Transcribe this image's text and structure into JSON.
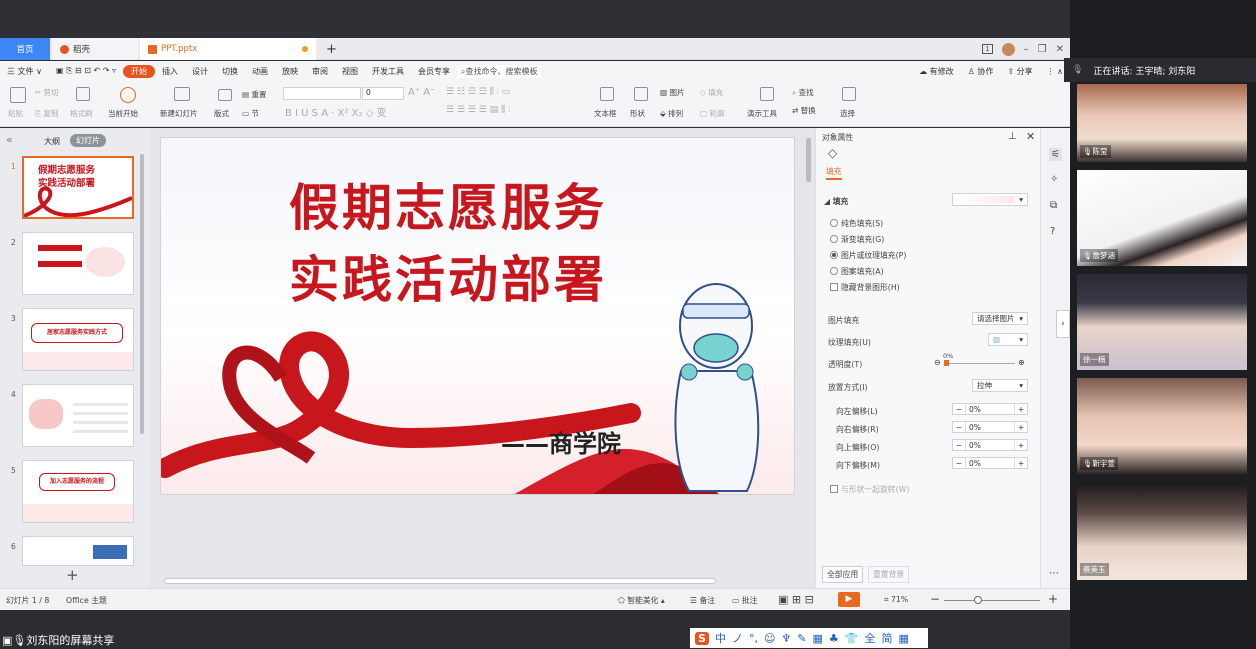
{
  "tabs": {
    "home": "首页",
    "docer": "稻壳",
    "ppt": "PPT.pptx",
    "add": "+"
  },
  "menu": {
    "file": "三 文件 ∨",
    "items": [
      "开始",
      "插入",
      "设计",
      "切换",
      "动画",
      "放映",
      "审阅",
      "视图",
      "开发工具",
      "会员专享"
    ],
    "search": "查找命令、搜索模板",
    "edit": "有修改",
    "collab": "协作",
    "share": "分享"
  },
  "ribbon": {
    "paste": "粘贴",
    "cut": "剪切",
    "copy": "复制",
    "format": "格式刷",
    "start_from": "当前开始",
    "new_slide": "新建幻灯片",
    "layout": "版式",
    "section": "节",
    "reset": "重置",
    "font_size": "0",
    "textbox": "文本框",
    "shape": "形状",
    "arrange": "排列",
    "picture": "图片",
    "fill": "填充",
    "outline": "轮廓",
    "present_tools": "演示工具",
    "find": "查找",
    "replace": "替换",
    "select": "选择"
  },
  "thumbs": {
    "outline": "大纲",
    "slides": "幻灯片",
    "nums": [
      "1",
      "2",
      "3",
      "4",
      "5",
      "6"
    ],
    "add": "+",
    "t1a": "假期志愿服务",
    "t1b": "实践活动部署",
    "t3": "居家志愿服务实践方式",
    "t5": "加入志愿服务的流程"
  },
  "slide": {
    "line1": "假期志愿服务",
    "line2": "实践活动部署",
    "sub": "——商学院"
  },
  "props": {
    "title": "对象属性",
    "tab": "填充",
    "section": "填充",
    "options": [
      "纯色填充(S)",
      "渐变填充(G)",
      "图片或纹理填充(P)",
      "图案填充(A)"
    ],
    "hide_bg": "隐藏背景图形(H)",
    "pic_fill": "图片填充",
    "pic_choose": "请选择图片",
    "texture": "纹理填充(U)",
    "transparency": "透明度(T)",
    "transparency_val": "0%",
    "placement": "放置方式(I)",
    "placement_val": "拉伸",
    "offsets": [
      {
        "label": "向左偏移(L)",
        "val": "0%"
      },
      {
        "label": "向右偏移(R)",
        "val": "0%"
      },
      {
        "label": "向上偏移(O)",
        "val": "0%"
      },
      {
        "label": "向下偏移(M)",
        "val": "0%"
      }
    ],
    "rotate": "与形状一起旋转(W)",
    "apply_all": "全部应用",
    "reset_bg": "重置背景"
  },
  "status": {
    "slide": "幻灯片 1 / 8",
    "theme": "Office 主题",
    "beautify": "智能美化",
    "notes": "备注",
    "comment": "批注",
    "zoom": "71%"
  },
  "share": {
    "label": "刘东阳的屏幕共享"
  },
  "meeting": {
    "speaking": "正在讲话: 王宇晴; 刘东阳",
    "people": [
      "陈莹",
      "詹梦涵",
      "徐一楠",
      "靳宇萱",
      "蔡美玉"
    ]
  },
  "ime": [
    "中",
    "ノ",
    "°,",
    "☺",
    "♆",
    "✎",
    "▦",
    "♣",
    "👕",
    "全",
    "简",
    "▦"
  ]
}
